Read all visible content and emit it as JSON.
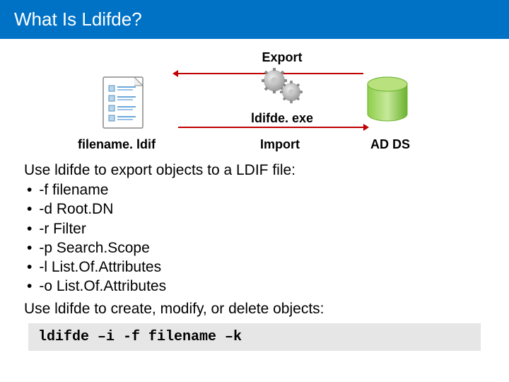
{
  "title": "What Is Ldifde?",
  "diagram": {
    "export_label": "Export",
    "tool_label": "ldifde. exe",
    "import_label": "Import",
    "filename_label": "filename. ldif",
    "adds_label": "AD DS"
  },
  "section1": {
    "heading": "Use ldifde to export objects to a LDIF file:",
    "items": [
      "-f filename",
      "-d Root.DN",
      "-r Filter",
      "-p Search.Scope",
      "-l List.Of.Attributes",
      "-o List.Of.Attributes"
    ]
  },
  "section2": {
    "heading": "Use ldifde to create, modify, or delete objects:",
    "command": "ldifde –i -f filename –k"
  }
}
